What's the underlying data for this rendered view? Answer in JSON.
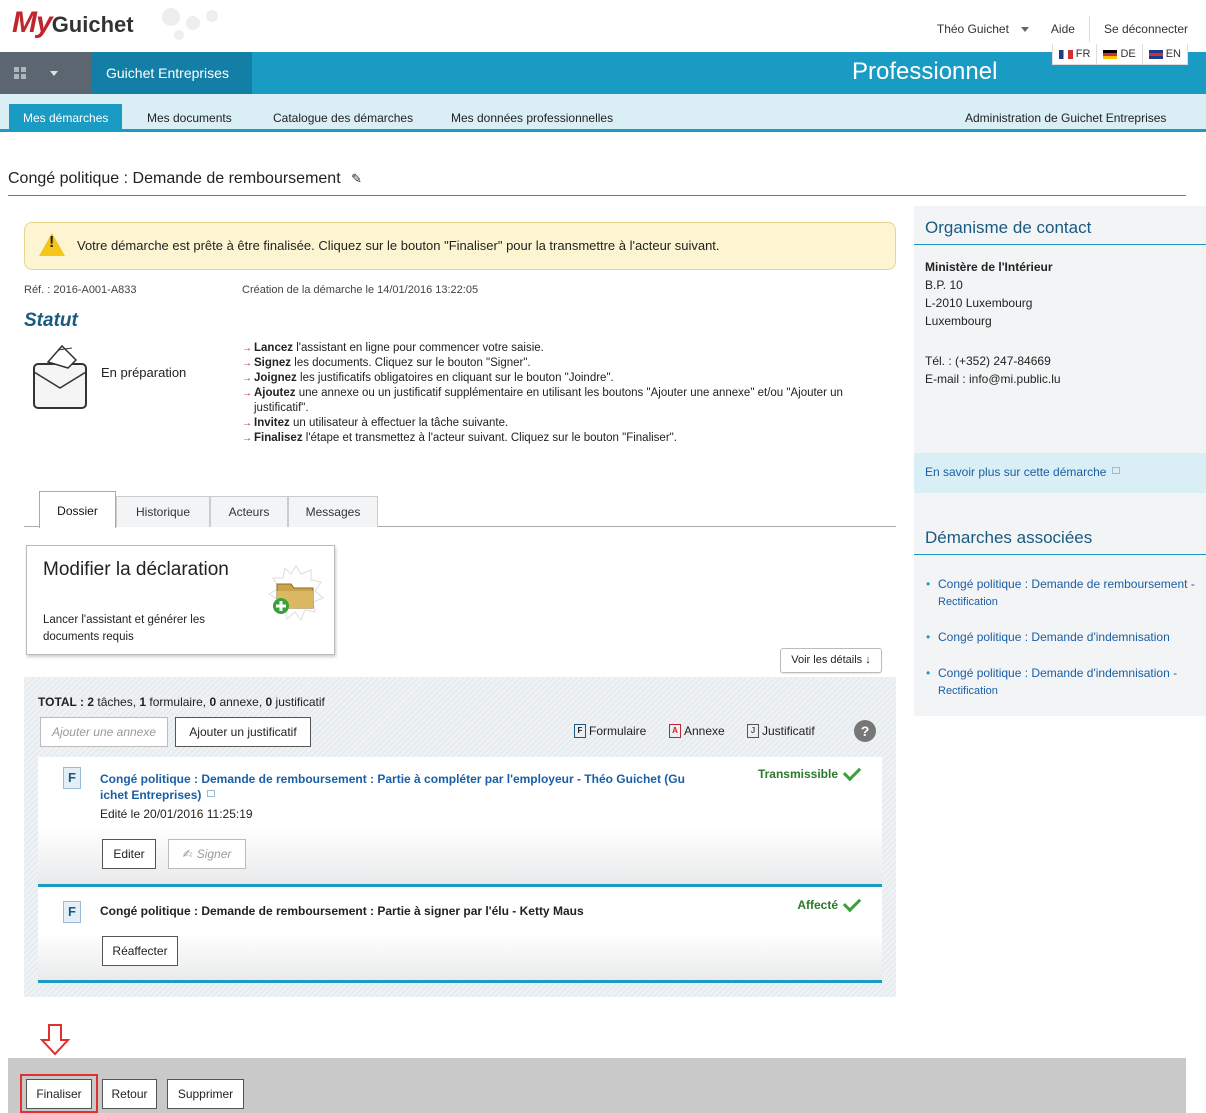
{
  "logo": {
    "my": "My",
    "rest": "Guichet"
  },
  "user_nav": {
    "user": "Théo Guichet",
    "help": "Aide",
    "logout": "Se déconnecter"
  },
  "banner": {
    "app": "Guichet Entreprises",
    "space": "Professionnel"
  },
  "langs": [
    "FR",
    "DE",
    "EN"
  ],
  "nav": {
    "items": [
      "Mes démarches",
      "Mes documents",
      "Catalogue des démarches",
      "Mes données professionnelles"
    ],
    "admin": "Administration de Guichet Entreprises"
  },
  "page": {
    "title": "Congé politique : Demande de remboursement"
  },
  "alert": {
    "text": "Votre démarche est prête à être finalisée. Cliquez sur le bouton \"Finaliser\" pour la transmettre à l'acteur suivant."
  },
  "meta": {
    "ref": "Réf. : 2016-A001-A833",
    "created": "Création de la démarche le 14/01/2016 13:22:05"
  },
  "statut": {
    "heading": "Statut",
    "value": "En préparation"
  },
  "steps": [
    {
      "bold": "Lancez",
      "rest": " l'assistant en ligne pour commencer votre saisie."
    },
    {
      "bold": "Signez",
      "rest": " les documents. Cliquez sur le bouton \"Signer\"."
    },
    {
      "bold": "Joignez",
      "rest": " les justificatifs obligatoires en cliquant sur le bouton \"Joindre\"."
    },
    {
      "bold": "Ajoutez",
      "rest": " une annexe ou un justificatif supplémentaire en utilisant les boutons \"Ajouter une annexe\" et/ou \"Ajouter un justificatif\"."
    },
    {
      "bold": "Invitez",
      "rest": " un utilisateur à effectuer la tâche suivante."
    },
    {
      "bold": "Finalisez",
      "rest": " l'étape et transmettez à l'acteur suivant. Cliquez sur le bouton \"Finaliser\"."
    }
  ],
  "tabs": [
    "Dossier",
    "Historique",
    "Acteurs",
    "Messages"
  ],
  "card": {
    "title": "Modifier la déclaration",
    "desc": "Lancer l'assistant et générer les documents requis"
  },
  "details_btn": "Voir les détails ↓",
  "total": {
    "label": "TOTAL :",
    "taches": "2",
    "taches_l": " tâches, ",
    "formulaire": "1",
    "formulaire_l": " formulaire, ",
    "annexe": "0",
    "annexe_l": " annexe, ",
    "justificatif": "0",
    "justificatif_l": " justificatif"
  },
  "actions": {
    "add_annex": "Ajouter une annexe",
    "add_just": "Ajouter un justificatif"
  },
  "legend": {
    "form": "Formulaire",
    "form_ic": "F",
    "annex": "Annexe",
    "annex_ic": "A",
    "just": "Justificatif",
    "just_ic": "J",
    "help": "?"
  },
  "tasks": [
    {
      "title": "Congé politique : Demande de remboursement : Partie à compléter par l'employeur - Théo Guichet (Gu ichet Entreprises)",
      "edited": "Edité le 20/01/2016 11:25:19",
      "status": "Transmissible",
      "btn1": "Editer",
      "btn2": "Signer",
      "icon": "F"
    },
    {
      "title": "Congé politique : Demande de remboursement : Partie à signer par l'élu - Ketty Maus",
      "status": "Affecté",
      "btn1": "Réaffecter",
      "icon": "F"
    }
  ],
  "sidebar": {
    "contact_h": "Organisme de contact",
    "org": "Ministère de l'Intérieur",
    "addr1": "B.P. 10",
    "addr2": "L-2010 Luxembourg",
    "addr3": "Luxembourg",
    "tel": "Tél. : (+352) 247-84669",
    "email": "E-mail : info@mi.public.lu",
    "more": "En savoir plus sur cette démarche",
    "assoc_h": "Démarches associées",
    "assoc": [
      {
        "main": "Congé politique : Demande de remboursement - ",
        "sub": "Rectification"
      },
      {
        "main": "Congé politique : Demande d'indemnisation",
        "sub": ""
      },
      {
        "main": "Congé politique : Demande d'indemnisation - ",
        "sub": "Rectification"
      }
    ]
  },
  "footer": {
    "finaliser": "Finaliser",
    "retour": "Retour",
    "supprimer": "Supprimer"
  }
}
